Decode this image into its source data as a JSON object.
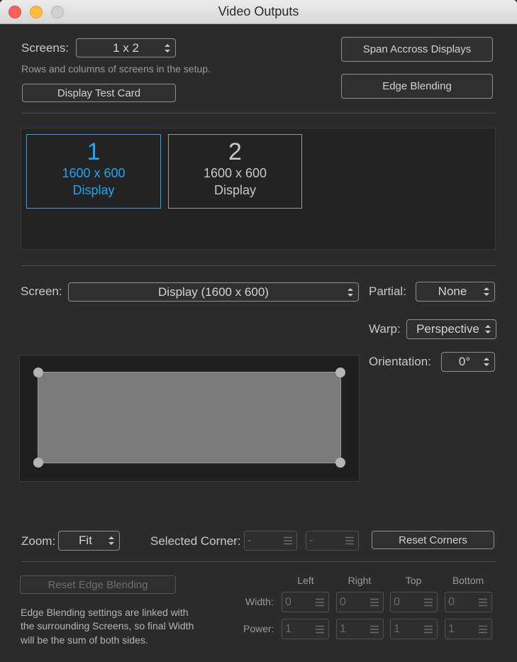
{
  "window": {
    "title": "Video Outputs"
  },
  "screens": {
    "label": "Screens:",
    "value": "1 x 2",
    "hint": "Rows and columns of screens in the setup."
  },
  "buttons": {
    "test_card": "Display Test Card",
    "span": "Span Accross Displays",
    "edge_blending": "Edge Blending",
    "reset_corners": "Reset Corners",
    "reset_edge": "Reset Edge Blending"
  },
  "tiles": [
    {
      "number": "1",
      "resolution": "1600 x 600",
      "name": "Display"
    },
    {
      "number": "2",
      "resolution": "1600 x 600",
      "name": "Display"
    }
  ],
  "screen_select": {
    "label": "Screen:",
    "value": "Display (1600 x 600)"
  },
  "partial": {
    "label": "Partial:",
    "value": "None"
  },
  "warp": {
    "label": "Warp:",
    "value": "Perspective"
  },
  "orientation": {
    "label": "Orientation:",
    "value": "0°"
  },
  "zoom": {
    "label": "Zoom:",
    "value": "Fit"
  },
  "selected_corner": {
    "label": "Selected Corner:",
    "x": "-",
    "y": "-"
  },
  "edge": {
    "columns": [
      "Left",
      "Right",
      "Top",
      "Bottom"
    ],
    "width_label": "Width:",
    "power_label": "Power:",
    "width_values": [
      "0",
      "0",
      "0",
      "0"
    ],
    "power_values": [
      "1",
      "1",
      "1",
      "1"
    ],
    "note_lines": [
      "Edge Blending settings are linked with",
      "the surrounding Screens, so final Width",
      "will be the sum of both sides."
    ]
  },
  "colors": {
    "selected_accent": "#1ea7f0",
    "close": "#fc605b",
    "minimize": "#fdbc40",
    "zoom_disabled": "#d0d0d0"
  }
}
